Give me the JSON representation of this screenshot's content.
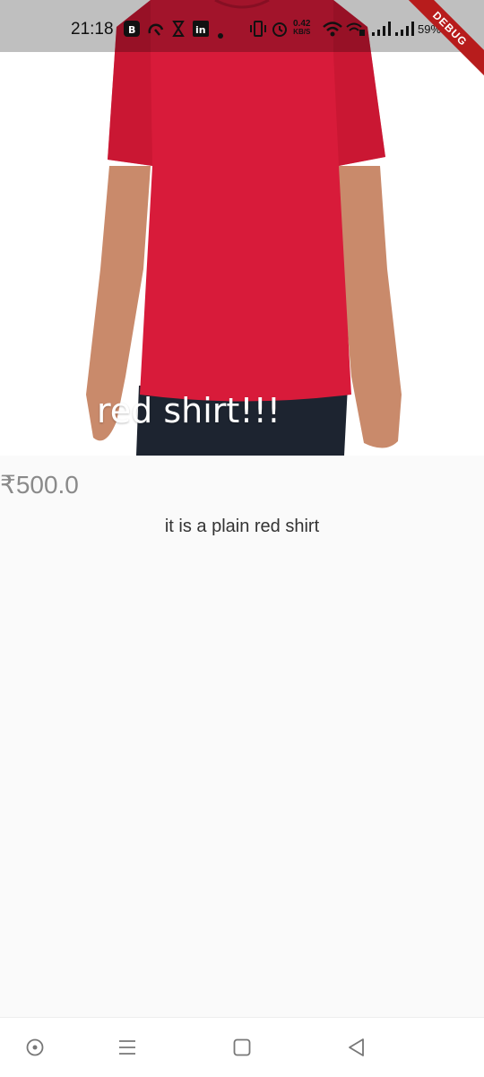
{
  "status_bar": {
    "time": "21:18",
    "net_speed_value": "0.42",
    "net_speed_unit": "KB/S",
    "battery_percent": "59%",
    "icons": [
      "bold-app-icon",
      "cloud-sync-icon",
      "hourglass-icon",
      "linkedin-icon",
      "dot-icon",
      "vibrate-icon",
      "alarm-icon",
      "wifi-icon",
      "signal-icon",
      "signal-icon-2",
      "battery-icon"
    ]
  },
  "debug_banner": "DEBUG",
  "product": {
    "title": "red shirt!!!",
    "price": "₹500.0",
    "description": "it is a plain red shirt",
    "shirt_color": "#d81b3a",
    "jeans_color": "#1d2430",
    "skin_color": "#c98a6b"
  },
  "nav_bar": {
    "buttons": [
      "assistant-button",
      "recent-apps-button",
      "home-button",
      "back-button"
    ]
  }
}
